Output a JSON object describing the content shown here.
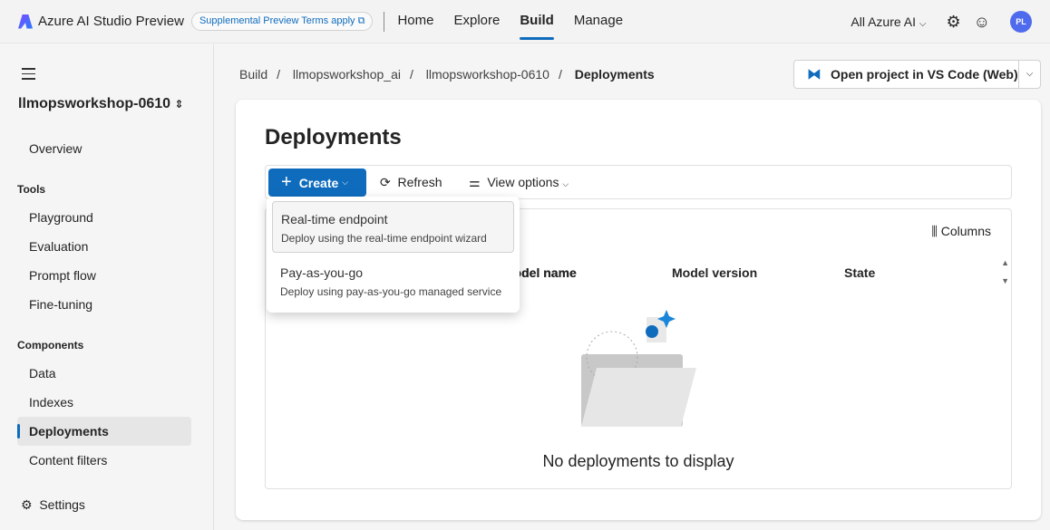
{
  "header": {
    "brand": "Azure AI Studio",
    "brand_suffix": "Preview",
    "pill": "Supplemental Preview Terms apply",
    "nav": [
      "Home",
      "Explore",
      "Build",
      "Manage"
    ],
    "active_nav": "Build",
    "scope": "All Azure AI",
    "avatar": "PL"
  },
  "sidebar": {
    "project": "llmopsworkshop-0610",
    "overview": "Overview",
    "tools_label": "Tools",
    "tools": [
      "Playground",
      "Evaluation",
      "Prompt flow",
      "Fine-tuning"
    ],
    "components_label": "Components",
    "components": [
      "Data",
      "Indexes",
      "Deployments",
      "Content filters"
    ],
    "selected": "Deployments",
    "settings": "Settings"
  },
  "breadcrumb": [
    "Build",
    "llmopsworkshop_ai",
    "llmopsworkshop-0610",
    "Deployments"
  ],
  "vscode_button": "Open project in VS Code (Web)",
  "main": {
    "title": "Deployments",
    "create": "Create",
    "refresh": "Refresh",
    "view_options": "View options",
    "columns": "Columns",
    "headers": [
      "Model name",
      "Model version",
      "State"
    ],
    "header_partial": "del name",
    "empty": "No deployments to display"
  },
  "create_menu": [
    {
      "title": "Real-time endpoint",
      "desc": "Deploy using the real-time endpoint wizard"
    },
    {
      "title": "Pay-as-you-go",
      "desc": "Deploy using pay-as-you-go managed service"
    }
  ],
  "colors": {
    "accent": "#0f6cbd",
    "avatar": "#4f6bed"
  }
}
